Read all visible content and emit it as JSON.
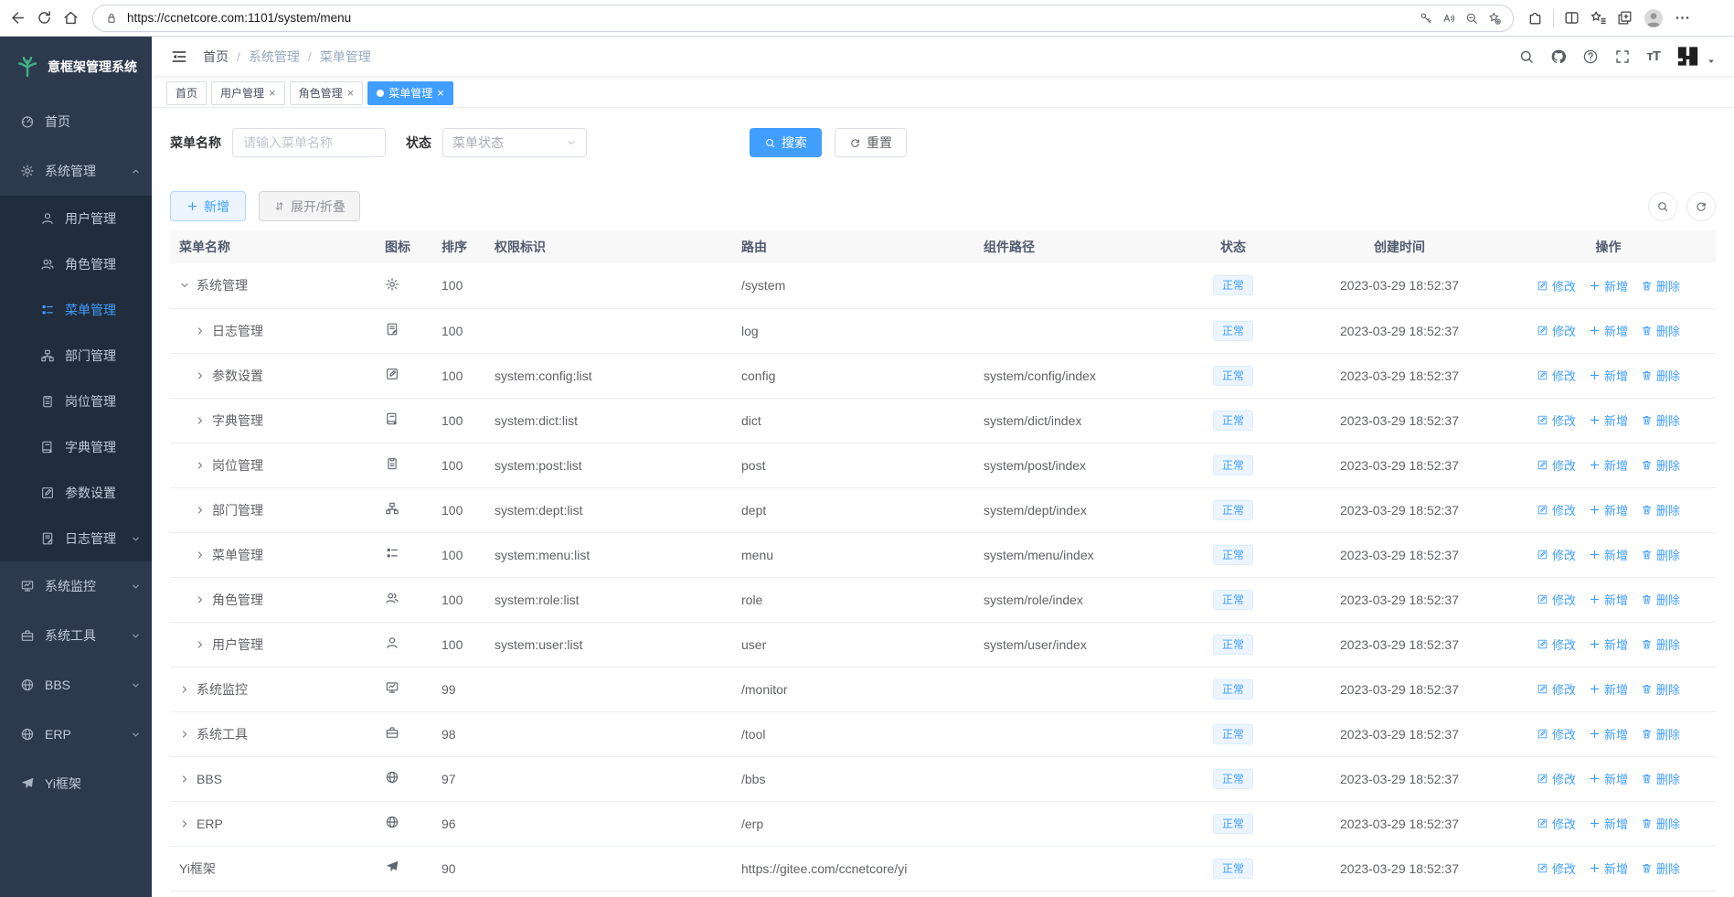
{
  "browser": {
    "url": "https://ccnetcore.com:1101/system/menu"
  },
  "sidebar": {
    "logo_text": "意框架管理系统",
    "items": [
      {
        "id": "home",
        "label": "首页",
        "icon": "dashboard-icon",
        "sub": false
      },
      {
        "id": "system-management",
        "label": "系统管理",
        "icon": "gear-icon",
        "sub": false,
        "chevron": "up",
        "open": true
      },
      {
        "id": "user-management",
        "label": "用户管理",
        "icon": "user-icon",
        "sub": true
      },
      {
        "id": "role-management",
        "label": "角色管理",
        "icon": "users-icon",
        "sub": true
      },
      {
        "id": "menu-management",
        "label": "菜单管理",
        "icon": "menu-list-icon",
        "sub": true,
        "active": true
      },
      {
        "id": "dept-management",
        "label": "部门管理",
        "icon": "tree-icon",
        "sub": true
      },
      {
        "id": "post-management",
        "label": "岗位管理",
        "icon": "badge-icon",
        "sub": true
      },
      {
        "id": "dict-management",
        "label": "字典管理",
        "icon": "book-icon",
        "sub": true
      },
      {
        "id": "param-settings",
        "label": "参数设置",
        "icon": "edit-square-icon",
        "sub": true
      },
      {
        "id": "log-management",
        "label": "日志管理",
        "icon": "log-icon",
        "sub": true,
        "chevron": "down"
      },
      {
        "id": "system-monitor",
        "label": "系统监控",
        "icon": "monitor-icon",
        "sub": false,
        "chevron": "down"
      },
      {
        "id": "system-tools",
        "label": "系统工具",
        "icon": "toolbox-icon",
        "sub": false,
        "chevron": "down"
      },
      {
        "id": "bbs",
        "label": "BBS",
        "icon": "globe-icon",
        "sub": false,
        "chevron": "down"
      },
      {
        "id": "erp",
        "label": "ERP",
        "icon": "globe-icon",
        "sub": false,
        "chevron": "down"
      },
      {
        "id": "yi-framework",
        "label": "Yi框架",
        "icon": "plane-icon",
        "sub": false
      }
    ]
  },
  "header": {
    "breadcrumb": [
      "首页",
      "系统管理",
      "菜单管理"
    ],
    "font_icon_text": "тT"
  },
  "tabs": [
    {
      "id": "home",
      "label": "首页",
      "closable": false,
      "active": false
    },
    {
      "id": "user-management",
      "label": "用户管理",
      "closable": true,
      "active": false
    },
    {
      "id": "role-management",
      "label": "角色管理",
      "closable": true,
      "active": false
    },
    {
      "id": "menu-management",
      "label": "菜单管理",
      "closable": true,
      "active": true
    }
  ],
  "filters": {
    "name_label": "菜单名称",
    "name_placeholder": "请输入菜单名称",
    "status_label": "状态",
    "status_placeholder": "菜单状态",
    "search_label": "搜索",
    "reset_label": "重置"
  },
  "toolbar": {
    "add_label": "新增",
    "expand_label": "展开/折叠"
  },
  "table": {
    "columns": [
      "菜单名称",
      "图标",
      "排序",
      "权限标识",
      "路由",
      "组件路径",
      "状态",
      "创建时间",
      "操作"
    ],
    "actions": {
      "edit": "修改",
      "add": "新增",
      "delete": "删除"
    },
    "rows": [
      {
        "name": "系统管理",
        "icon": "gear-icon",
        "indent": 0,
        "arrow": "down",
        "order": "100",
        "perm": "",
        "route": "/system",
        "component": "",
        "status": "正常",
        "created": "2023-03-29 18:52:37"
      },
      {
        "name": "日志管理",
        "icon": "log-icon",
        "indent": 1,
        "arrow": "right",
        "order": "100",
        "perm": "",
        "route": "log",
        "component": "",
        "status": "正常",
        "created": "2023-03-29 18:52:37"
      },
      {
        "name": "参数设置",
        "icon": "edit-square-icon",
        "indent": 1,
        "arrow": "right",
        "order": "100",
        "perm": "system:config:list",
        "route": "config",
        "component": "system/config/index",
        "status": "正常",
        "created": "2023-03-29 18:52:37"
      },
      {
        "name": "字典管理",
        "icon": "book-icon",
        "indent": 1,
        "arrow": "right",
        "order": "100",
        "perm": "system:dict:list",
        "route": "dict",
        "component": "system/dict/index",
        "status": "正常",
        "created": "2023-03-29 18:52:37"
      },
      {
        "name": "岗位管理",
        "icon": "badge-icon",
        "indent": 1,
        "arrow": "right",
        "order": "100",
        "perm": "system:post:list",
        "route": "post",
        "component": "system/post/index",
        "status": "正常",
        "created": "2023-03-29 18:52:37"
      },
      {
        "name": "部门管理",
        "icon": "tree-icon",
        "indent": 1,
        "arrow": "right",
        "order": "100",
        "perm": "system:dept:list",
        "route": "dept",
        "component": "system/dept/index",
        "status": "正常",
        "created": "2023-03-29 18:52:37"
      },
      {
        "name": "菜单管理",
        "icon": "menu-list-icon",
        "indent": 1,
        "arrow": "right",
        "order": "100",
        "perm": "system:menu:list",
        "route": "menu",
        "component": "system/menu/index",
        "status": "正常",
        "created": "2023-03-29 18:52:37"
      },
      {
        "name": "角色管理",
        "icon": "users-icon",
        "indent": 1,
        "arrow": "right",
        "order": "100",
        "perm": "system:role:list",
        "route": "role",
        "component": "system/role/index",
        "status": "正常",
        "created": "2023-03-29 18:52:37"
      },
      {
        "name": "用户管理",
        "icon": "user-icon",
        "indent": 1,
        "arrow": "right",
        "order": "100",
        "perm": "system:user:list",
        "route": "user",
        "component": "system/user/index",
        "status": "正常",
        "created": "2023-03-29 18:52:37"
      },
      {
        "name": "系统监控",
        "icon": "monitor-icon",
        "indent": 0,
        "arrow": "right",
        "order": "99",
        "perm": "",
        "route": "/monitor",
        "component": "",
        "status": "正常",
        "created": "2023-03-29 18:52:37"
      },
      {
        "name": "系统工具",
        "icon": "toolbox-icon",
        "indent": 0,
        "arrow": "right",
        "order": "98",
        "perm": "",
        "route": "/tool",
        "component": "",
        "status": "正常",
        "created": "2023-03-29 18:52:37"
      },
      {
        "name": "BBS",
        "icon": "globe-icon",
        "indent": 0,
        "arrow": "right",
        "order": "97",
        "perm": "",
        "route": "/bbs",
        "component": "",
        "status": "正常",
        "created": "2023-03-29 18:52:37"
      },
      {
        "name": "ERP",
        "icon": "globe-icon",
        "indent": 0,
        "arrow": "right",
        "order": "96",
        "perm": "",
        "route": "/erp",
        "component": "",
        "status": "正常",
        "created": "2023-03-29 18:52:37"
      },
      {
        "name": "Yi框架",
        "icon": "plane-icon",
        "indent": 0,
        "arrow": "none",
        "order": "90",
        "perm": "",
        "route": "https://gitee.com/ccnetcore/yi",
        "component": "",
        "status": "正常",
        "created": "2023-03-29 18:52:37"
      }
    ]
  },
  "colors": {
    "accent": "#409eff",
    "sidebar_bg": "#2d3a4e",
    "submenu_bg": "#212c3c",
    "badge_bg": "#ecf5ff",
    "badge_border": "#d9ecff",
    "badge_text": "#409eff"
  }
}
